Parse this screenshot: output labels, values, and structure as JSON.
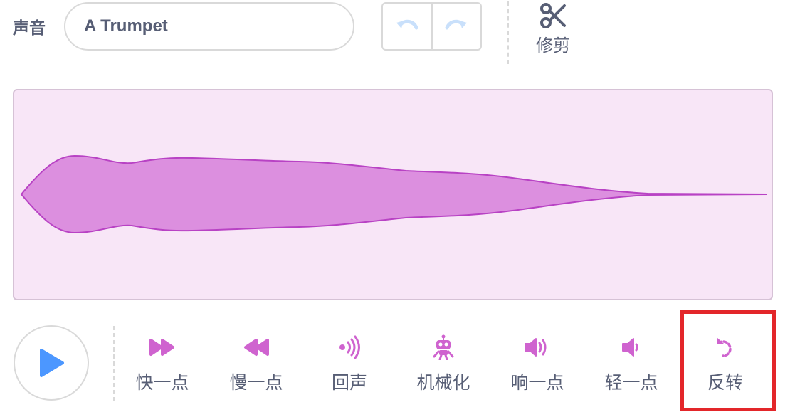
{
  "header": {
    "sound_label": "声音",
    "sound_name": "A Trumpet",
    "trim_label": "修剪"
  },
  "icons": {
    "undo": "undo-arrow-icon",
    "redo": "redo-arrow-icon",
    "trim": "scissors-icon",
    "play": "play-triangle-icon"
  },
  "effects": [
    {
      "id": "faster",
      "label": "快一点",
      "icon": "fast-forward-icon"
    },
    {
      "id": "slower",
      "label": "慢一点",
      "icon": "rewind-icon"
    },
    {
      "id": "echo",
      "label": "回声",
      "icon": "echo-waves-icon"
    },
    {
      "id": "robot",
      "label": "机械化",
      "icon": "robot-icon"
    },
    {
      "id": "louder",
      "label": "响一点",
      "icon": "speaker-loud-icon"
    },
    {
      "id": "softer",
      "label": "轻一点",
      "icon": "speaker-soft-icon"
    },
    {
      "id": "reverse",
      "label": "反转",
      "icon": "reverse-arrow-icon"
    }
  ],
  "colors": {
    "accent": "#cf63cf",
    "waveform_fill": "#dc8fdf",
    "waveform_stroke": "#b842c4",
    "waveform_bg": "#f8e6f7",
    "play": "#4c97ff",
    "highlight": "#e3262a",
    "text": "#575e75"
  }
}
